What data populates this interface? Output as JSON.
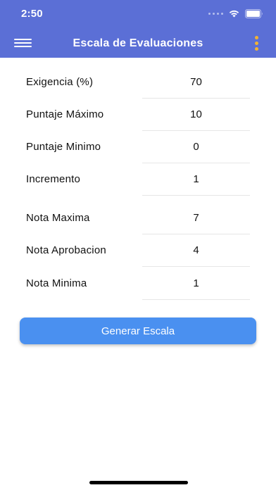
{
  "status_bar": {
    "time": "2:50"
  },
  "nav": {
    "title": "Escala de Evaluaciones"
  },
  "form": {
    "rows": [
      {
        "label": "Exigencia (%)",
        "value": "70"
      },
      {
        "label": "Puntaje Máximo",
        "value": "10"
      },
      {
        "label": "Puntaje Minimo",
        "value": "0"
      },
      {
        "label": "Incremento",
        "value": "1"
      },
      {
        "label": "Nota Maxima",
        "value": "7"
      },
      {
        "label": "Nota Aprobacion",
        "value": "4"
      },
      {
        "label": "Nota Minima",
        "value": "1"
      }
    ]
  },
  "actions": {
    "generate_label": "Generar Escala"
  },
  "colors": {
    "header": "#5b6fd6",
    "button": "#4a90f0",
    "more_icon": "#f2b233"
  }
}
